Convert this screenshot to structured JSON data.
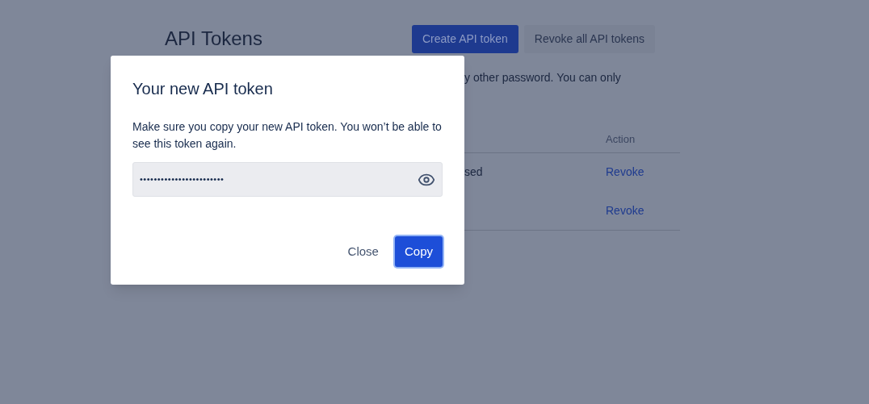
{
  "page": {
    "title": "API Tokens",
    "buttons": [
      {
        "label": "Create API token",
        "kind": "primary"
      },
      {
        "label": "Revoke all API tokens",
        "kind": "secondary"
      }
    ],
    "description": "y other password. You can only",
    "table": {
      "columns": [
        "Action"
      ],
      "rows": [
        {
          "column_1": "sed",
          "action": "Revoke"
        },
        {
          "column_1": "",
          "action": "Revoke"
        }
      ]
    }
  },
  "dialog": {
    "title": "Your new API token",
    "message": "Make sure you copy your new API token. You won’t be able to see this token again.",
    "token_field": {
      "value": "••••••••••••••••••••••••"
    },
    "buttons": [
      {
        "label": "Close",
        "kind": "subtle"
      },
      {
        "label": "Copy",
        "kind": "primary"
      }
    ]
  }
}
